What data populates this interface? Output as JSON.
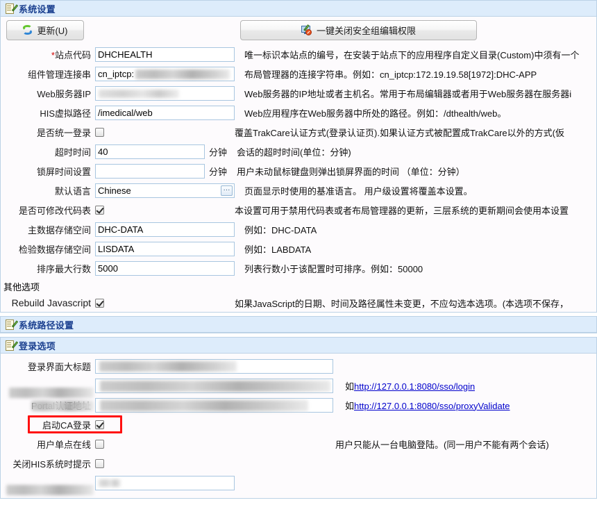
{
  "sections": {
    "system_settings": {
      "title": "系统设置",
      "icon": "note-edit-icon"
    },
    "system_path_settings": {
      "title": "系统路径设置",
      "icon": "note-edit-icon"
    },
    "login_options": {
      "title": "登录选项",
      "icon": "note-edit-icon"
    }
  },
  "toolbar": {
    "update_label": "更新(U)",
    "update_icon": "refresh-icon",
    "close_perm_label": "一键关闭安全组编辑权限",
    "close_perm_icon": "monitor-deny-icon"
  },
  "fields": [
    {
      "label": "站点代码",
      "required": true,
      "value": "DHCHEALTH",
      "hint": "唯一标识本站点的编号，在安装于站点下的应用程序自定义目录(Custom)中须有一个"
    },
    {
      "label": "组件管理连接串",
      "required": false,
      "value": "cn_iptcp:",
      "redacted": true,
      "hint": "布局管理器的连接字符串。例如：cn_iptcp:172.19.19.58[1972]:DHC-APP"
    },
    {
      "label": "Web服务器IP",
      "required": false,
      "value": "",
      "redacted": true,
      "hint": "Web服务器的IP地址或者主机名。常用于布局编辑器或者用于Web服务器在服务器i"
    },
    {
      "label": "HIS虚拟路径",
      "required": false,
      "value": "/imedical/web",
      "hint": "Web应用程序在Web服务器中所处的路径。例如：/dthealth/web。"
    },
    {
      "label": "是否统一登录",
      "type": "checkbox",
      "checked": false,
      "hint": "覆盖TrakCare认证方式(登录认证页).如果认证方式被配置成TrakCare以外的方式(仮"
    },
    {
      "label": "超时时间",
      "value": "40",
      "unit": "分钟",
      "hint": "会话的超时时间(单位：分钟)"
    },
    {
      "label": "锁屏时间设置",
      "value": "",
      "unit": "分钟",
      "hint": "用户未动鼠标键盘则弹出锁屏界面的时间 （单位：分钟）"
    },
    {
      "label": "默认语言",
      "value": "Chinese",
      "picker": "···",
      "hint": "页面显示时使用的基准语言。 用户级设置将覆盖本设置。"
    },
    {
      "label": "是否可修改代码表",
      "type": "checkbox",
      "checked": true,
      "hint": "本设置可用于禁用代码表或者布局管理器的更新，三层系统的更新期间会使用本设置"
    },
    {
      "label": "主数据存储空间",
      "value": "DHC-DATA",
      "hint": "例如：DHC-DATA"
    },
    {
      "label": "检验数据存储空间",
      "value": "LISDATA",
      "hint": "例如：LABDATA"
    },
    {
      "label": "排序最大行数",
      "value": "5000",
      "hint": "列表行数小于该配置时可排序。例如：50000"
    }
  ],
  "other_options": {
    "group_label": "其他选项",
    "rebuild": {
      "label": "Rebuild Javascript",
      "type": "checkbox",
      "checked": true,
      "hint": "如果JavaScript的日期、时间及路径属性未变更，不应勾选本选项。(本选项不保存，"
    }
  },
  "login_fields": [
    {
      "label": "登录界面大标题",
      "label_redacted": false,
      "value": "",
      "redacted": true,
      "hint": ""
    },
    {
      "label": "",
      "label_redacted": true,
      "value": "",
      "redacted": true,
      "hint_prefix": "如",
      "hint_link": "http://127.0.0.1:8080/sso/login"
    },
    {
      "label": "Portal认证地址",
      "label_redacted": true,
      "value": "",
      "redacted": true,
      "hint_prefix": "如",
      "hint_link": "http://127.0.0.1:8080/sso/proxyValidate"
    },
    {
      "label": "启动CA登录",
      "type": "checkbox",
      "checked": true,
      "highlighted": true,
      "hint": ""
    },
    {
      "label": "用户单点在线",
      "type": "checkbox",
      "checked": false,
      "hint": "用户只能从一台电脑登陆。(同一用户不能有两个会话)"
    },
    {
      "label": "关闭HIS系统时提示",
      "type": "checkbox",
      "checked": false,
      "hint": ""
    },
    {
      "label": "",
      "label_redacted": true,
      "value": "",
      "redacted": true,
      "hint": ""
    }
  ]
}
